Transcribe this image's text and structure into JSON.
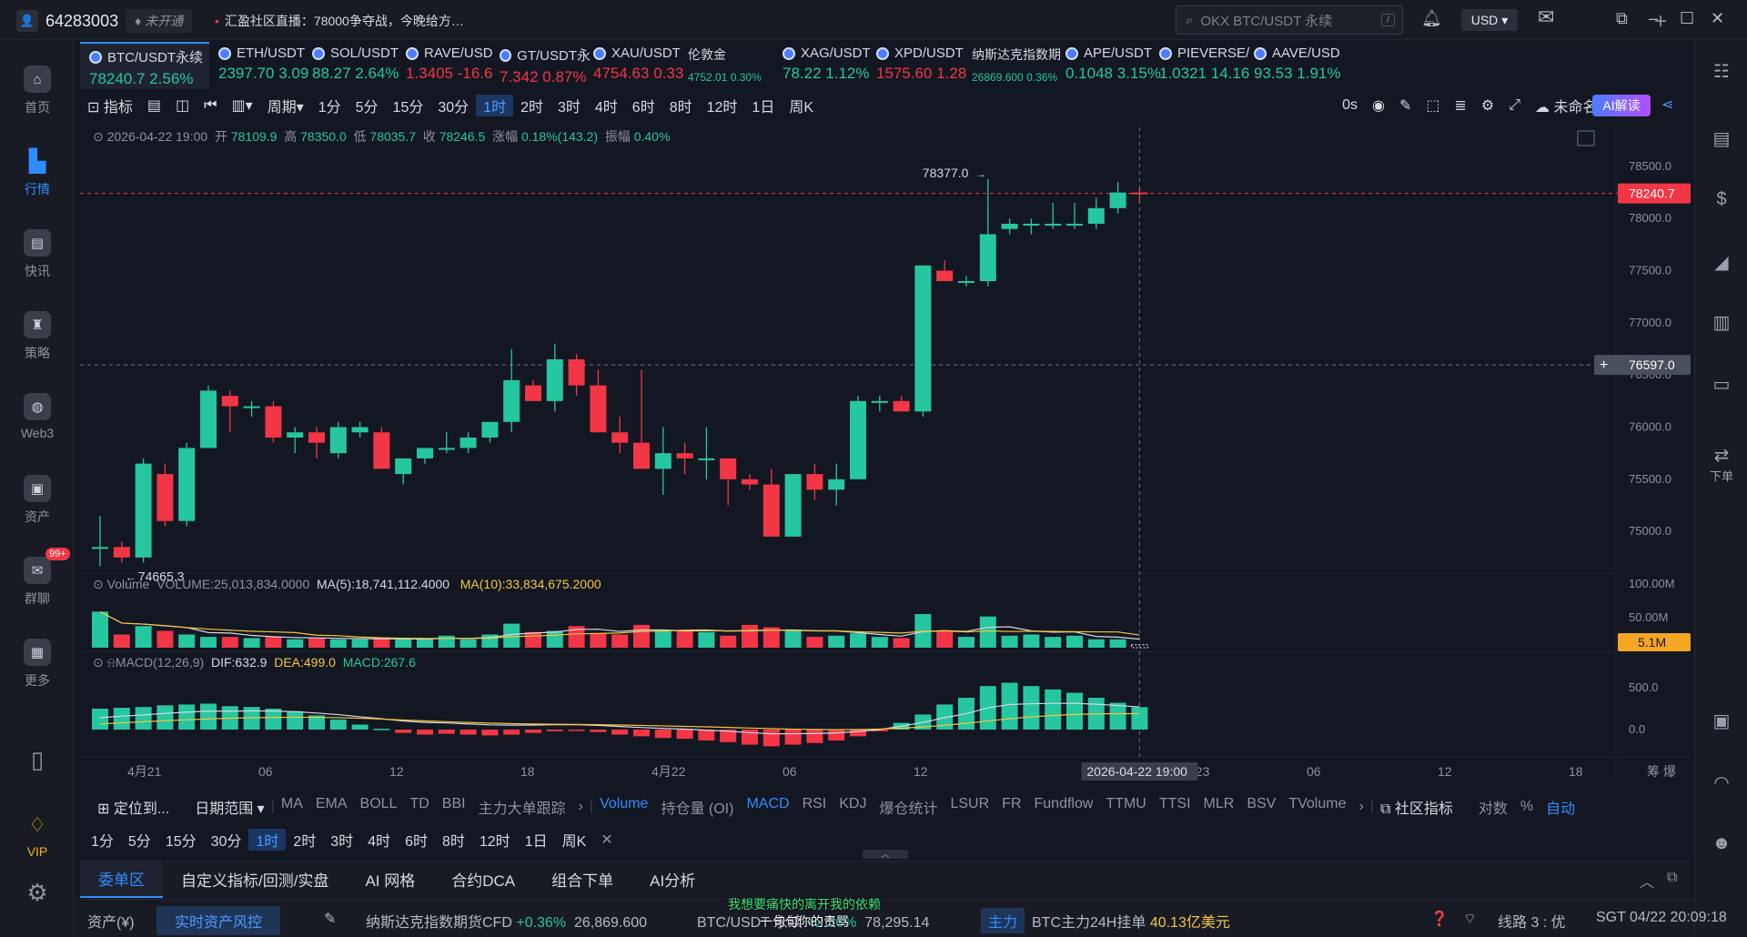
{
  "topbar": {
    "user_id": "64283003",
    "status_tag": "未开通",
    "broadcast": "汇盈社区直播：78000争夺战，今晚给方…",
    "search_placeholder": "OKX BTC/USDT 永续",
    "search_shortcut": "/",
    "currency": "USD"
  },
  "left_nav": [
    {
      "label": "首页",
      "icon": "home-icon"
    },
    {
      "label": "行情",
      "icon": "market-chart-icon",
      "active": true
    },
    {
      "label": "快讯",
      "icon": "news-icon"
    },
    {
      "label": "策略",
      "icon": "strategy-icon"
    },
    {
      "label": "Web3",
      "icon": "web3-icon"
    },
    {
      "label": "资产",
      "icon": "wallet-icon"
    },
    {
      "label": "群聊",
      "icon": "chat-icon",
      "badge": "99+"
    },
    {
      "label": "更多",
      "icon": "more-grid-icon"
    },
    {
      "label": "VIP",
      "icon": "vip-diamond-icon"
    }
  ],
  "right_nav": {
    "order_label": "下单"
  },
  "symbols": [
    {
      "name": "BTC/USDT永续",
      "price": "78240.7",
      "change": "2.56%",
      "dir": "up",
      "active": true
    },
    {
      "name": "ETH/USDT",
      "price": "2397.70",
      "change": "3.09",
      "dir": "up"
    },
    {
      "name": "SOL/USDT",
      "price": "88.27",
      "change": "2.64%",
      "dir": "up"
    },
    {
      "name": "RAVE/USD",
      "price": "1.3405",
      "change": "-16.6",
      "dir": "dn"
    },
    {
      "name": "GT/USDT永",
      "price": "7.342",
      "change": "0.87%",
      "dir": "dn"
    },
    {
      "name": "XAU/USDT",
      "price": "4754.63",
      "change": "0.33",
      "dir": "dn"
    },
    {
      "name": "伦敦金",
      "price": "4752.01",
      "change": "0.30%",
      "dir": "up",
      "small": true
    },
    {
      "name": "XAG/USDT",
      "price": "78.22",
      "change": "1.12%",
      "dir": "up"
    },
    {
      "name": "XPD/USDT",
      "price": "1575.60",
      "change": "1.28",
      "dir": "dn"
    },
    {
      "name": "纳斯达克指数期",
      "price": "26869.600",
      "change": "0.36%",
      "dir": "up",
      "small": true
    },
    {
      "name": "APE/USDT",
      "price": "0.1048",
      "change": "3.15%",
      "dir": "up"
    },
    {
      "name": "PIEVERSE/",
      "price": "1.0321",
      "change": "14.16",
      "dir": "up"
    },
    {
      "name": "AAVE/USD",
      "price": "93.53",
      "change": "1.91%",
      "dir": "up"
    }
  ],
  "toolbar": {
    "indicator": "指标",
    "period": "周期",
    "intervals": [
      "1分",
      "5分",
      "15分",
      "30分",
      "1时",
      "2时",
      "3时",
      "4时",
      "6时",
      "8时",
      "12时",
      "1日",
      "周K"
    ],
    "active_interval": "1时",
    "countdown": "0s",
    "layout_name": "未命名",
    "ai_button": "AI解读"
  },
  "ohlc": {
    "datetime": "2026-04-22 19:00",
    "open_label": "开",
    "open": "78109.9",
    "high_label": "高",
    "high": "78350.0",
    "low_label": "低",
    "low": "78035.7",
    "close_label": "收",
    "close": "78246.5",
    "change_label": "涨幅",
    "change": "0.18%(143.2)",
    "amp_label": "振幅",
    "amp": "0.40%"
  },
  "price_axis": {
    "ticks": [
      "78500.0",
      "78000.0",
      "77500.0",
      "77000.0",
      "76500.0",
      "76000.0",
      "75500.0",
      "75000.0"
    ],
    "current_price": "78240.7",
    "crosshair_price": "76597.0",
    "high_mark": "78377.0",
    "low_mark": "74665.3"
  },
  "volume": {
    "title": "Volume",
    "text": "VOLUME:25,013,834.0000",
    "ma5": "MA(5):18,741,112.4000",
    "ma10": "MA(10):33,834,675.2000",
    "axis": [
      "100.00M",
      "50.00M"
    ],
    "current": "5.1M"
  },
  "macd": {
    "title": "MACD(12,26,9)",
    "dif": "DIF:632.9",
    "dea": "DEA:499.0",
    "macd": "MACD:267.6",
    "axis": [
      "500.0",
      "0.0"
    ]
  },
  "time_axis": {
    "labels": [
      "4月21",
      "06",
      "12",
      "18",
      "4月22",
      "06",
      "12",
      "4月23",
      "06",
      "12",
      "18"
    ],
    "cursor": "2026-04-22 19:00",
    "corner": "筹 爆"
  },
  "indicator_bar": {
    "locate": "定位到...",
    "range": "日期范围",
    "main": [
      "MA",
      "EMA",
      "BOLL",
      "TD",
      "BBI",
      "主力大单跟踪"
    ],
    "sub": [
      "Volume",
      "持仓量 (OI)",
      "MACD",
      "RSI",
      "KDJ",
      "爆仓统计",
      "LSUR",
      "FR",
      "Fundflow",
      "TTMU",
      "TTSI",
      "MLR",
      "BSV",
      "TVolume"
    ],
    "community": "社区指标",
    "log": "对数",
    "pct": "%",
    "auto": "自动"
  },
  "interval_bar": [
    "1分",
    "5分",
    "15分",
    "30分",
    "1时",
    "2时",
    "3时",
    "4时",
    "6时",
    "8时",
    "12时",
    "1日",
    "周K"
  ],
  "panel_tabs": [
    "委单区",
    "自定义指标/回测/实盘",
    "AI 网格",
    "合约DCA",
    "组合下单",
    "AI分析"
  ],
  "status": {
    "assets": "资产(¥)",
    "risk": "实时资产风控",
    "nasdaq_name": "纳斯达克指数期货CFD",
    "nasdaq_change": "+0.36%",
    "nasdaq_price": "26,869.600",
    "btc_name": "BTC/USDT 永续",
    "btc_change": "+2.56%",
    "btc_price": "78,295.14",
    "mainforce_tag": "主力",
    "mainforce_text": "BTC主力24H挂单",
    "mainforce_value": "40.13亿美元",
    "line": "线路 3 : 优",
    "clock": "SGT 04/22 20:09:18"
  },
  "subtitle": {
    "line1": "我想要痛快的离开我的依赖",
    "line2": "一句句你的责骂"
  },
  "colors": {
    "up": "#26c6a0",
    "down": "#f23645",
    "accent": "#2f8cff",
    "background": "#131722"
  },
  "chart_data": {
    "type": "candlestick",
    "interval": "1时",
    "candles": [
      {
        "o": 74850,
        "h": 75150,
        "l": 74665,
        "c": 74850
      },
      {
        "o": 74850,
        "h": 74900,
        "l": 74700,
        "c": 74750
      },
      {
        "o": 74750,
        "h": 75700,
        "l": 74700,
        "c": 75650
      },
      {
        "o": 75550,
        "h": 75650,
        "l": 75050,
        "c": 75100
      },
      {
        "o": 75100,
        "h": 75850,
        "l": 75050,
        "c": 75800
      },
      {
        "o": 75800,
        "h": 76400,
        "l": 75800,
        "c": 76350
      },
      {
        "o": 76300,
        "h": 76350,
        "l": 75950,
        "c": 76200
      },
      {
        "o": 76200,
        "h": 76250,
        "l": 76100,
        "c": 76200
      },
      {
        "o": 76200,
        "h": 76250,
        "l": 75850,
        "c": 75900
      },
      {
        "o": 75900,
        "h": 76000,
        "l": 75750,
        "c": 75950
      },
      {
        "o": 75950,
        "h": 76000,
        "l": 75700,
        "c": 75850
      },
      {
        "o": 75750,
        "h": 76050,
        "l": 75700,
        "c": 76000
      },
      {
        "o": 75950,
        "h": 76050,
        "l": 75900,
        "c": 76000
      },
      {
        "o": 75950,
        "h": 76000,
        "l": 75600,
        "c": 75600
      },
      {
        "o": 75550,
        "h": 75700,
        "l": 75450,
        "c": 75700
      },
      {
        "o": 75700,
        "h": 75800,
        "l": 75650,
        "c": 75800
      },
      {
        "o": 75800,
        "h": 75950,
        "l": 75750,
        "c": 75800
      },
      {
        "o": 75800,
        "h": 75950,
        "l": 75750,
        "c": 75900
      },
      {
        "o": 75900,
        "h": 76050,
        "l": 75850,
        "c": 76050
      },
      {
        "o": 76050,
        "h": 76750,
        "l": 75950,
        "c": 76450
      },
      {
        "o": 76400,
        "h": 76450,
        "l": 76250,
        "c": 76250
      },
      {
        "o": 76250,
        "h": 76800,
        "l": 76150,
        "c": 76650
      },
      {
        "o": 76650,
        "h": 76700,
        "l": 76300,
        "c": 76400
      },
      {
        "o": 76400,
        "h": 76550,
        "l": 75950,
        "c": 75950
      },
      {
        "o": 75950,
        "h": 76100,
        "l": 75750,
        "c": 75850
      },
      {
        "o": 75850,
        "h": 76550,
        "l": 75600,
        "c": 75600
      },
      {
        "o": 75600,
        "h": 76000,
        "l": 75350,
        "c": 75750
      },
      {
        "o": 75750,
        "h": 75850,
        "l": 75550,
        "c": 75700
      },
      {
        "o": 75700,
        "h": 76000,
        "l": 75500,
        "c": 75700
      },
      {
        "o": 75700,
        "h": 75700,
        "l": 75250,
        "c": 75500
      },
      {
        "o": 75500,
        "h": 75550,
        "l": 75400,
        "c": 75450
      },
      {
        "o": 75450,
        "h": 75600,
        "l": 74950,
        "c": 74950
      },
      {
        "o": 74950,
        "h": 75550,
        "l": 74950,
        "c": 75550
      },
      {
        "o": 75550,
        "h": 75650,
        "l": 75300,
        "c": 75400
      },
      {
        "o": 75400,
        "h": 75650,
        "l": 75250,
        "c": 75500
      },
      {
        "o": 75500,
        "h": 76300,
        "l": 75500,
        "c": 76250
      },
      {
        "o": 76250,
        "h": 76300,
        "l": 76150,
        "c": 76250
      },
      {
        "o": 76250,
        "h": 76300,
        "l": 76150,
        "c": 76150
      },
      {
        "o": 76150,
        "h": 77550,
        "l": 76100,
        "c": 77550
      },
      {
        "o": 77500,
        "h": 77600,
        "l": 77400,
        "c": 77400
      },
      {
        "o": 77400,
        "h": 77450,
        "l": 77350,
        "c": 77400
      },
      {
        "o": 77400,
        "h": 78377,
        "l": 77350,
        "c": 77850
      },
      {
        "o": 77900,
        "h": 78000,
        "l": 77850,
        "c": 77950
      },
      {
        "o": 77950,
        "h": 78000,
        "l": 77850,
        "c": 77950
      },
      {
        "o": 77950,
        "h": 78150,
        "l": 77900,
        "c": 77950
      },
      {
        "o": 77950,
        "h": 78150,
        "l": 77900,
        "c": 77950
      },
      {
        "o": 77950,
        "h": 78200,
        "l": 77900,
        "c": 78100
      },
      {
        "o": 78100,
        "h": 78350,
        "l": 78050,
        "c": 78250
      },
      {
        "o": 78250,
        "h": 78300,
        "l": 78150,
        "c": 78240
      }
    ],
    "volume_millions": [
      60,
      22,
      36,
      28,
      22,
      18,
      18,
      16,
      18,
      14,
      16,
      14,
      14,
      16,
      14,
      14,
      20,
      14,
      22,
      40,
      26,
      28,
      36,
      24,
      22,
      38,
      28,
      28,
      26,
      20,
      38,
      34,
      30,
      18,
      20,
      24,
      18,
      16,
      56,
      28,
      18,
      52,
      20,
      22,
      18,
      20,
      14,
      14,
      5
    ],
    "macd_hist": [
      250,
      260,
      270,
      290,
      300,
      310,
      280,
      270,
      250,
      220,
      170,
      120,
      60,
      10,
      -40,
      -60,
      -50,
      -60,
      -70,
      -60,
      -40,
      -20,
      -10,
      -30,
      -60,
      -80,
      -100,
      -110,
      -130,
      -150,
      -180,
      -200,
      -180,
      -160,
      -130,
      -80,
      -20,
      80,
      180,
      300,
      380,
      520,
      560,
      520,
      480,
      440,
      380,
      320,
      268
    ],
    "macd_axis": [
      "500.0",
      "0.0"
    ]
  }
}
